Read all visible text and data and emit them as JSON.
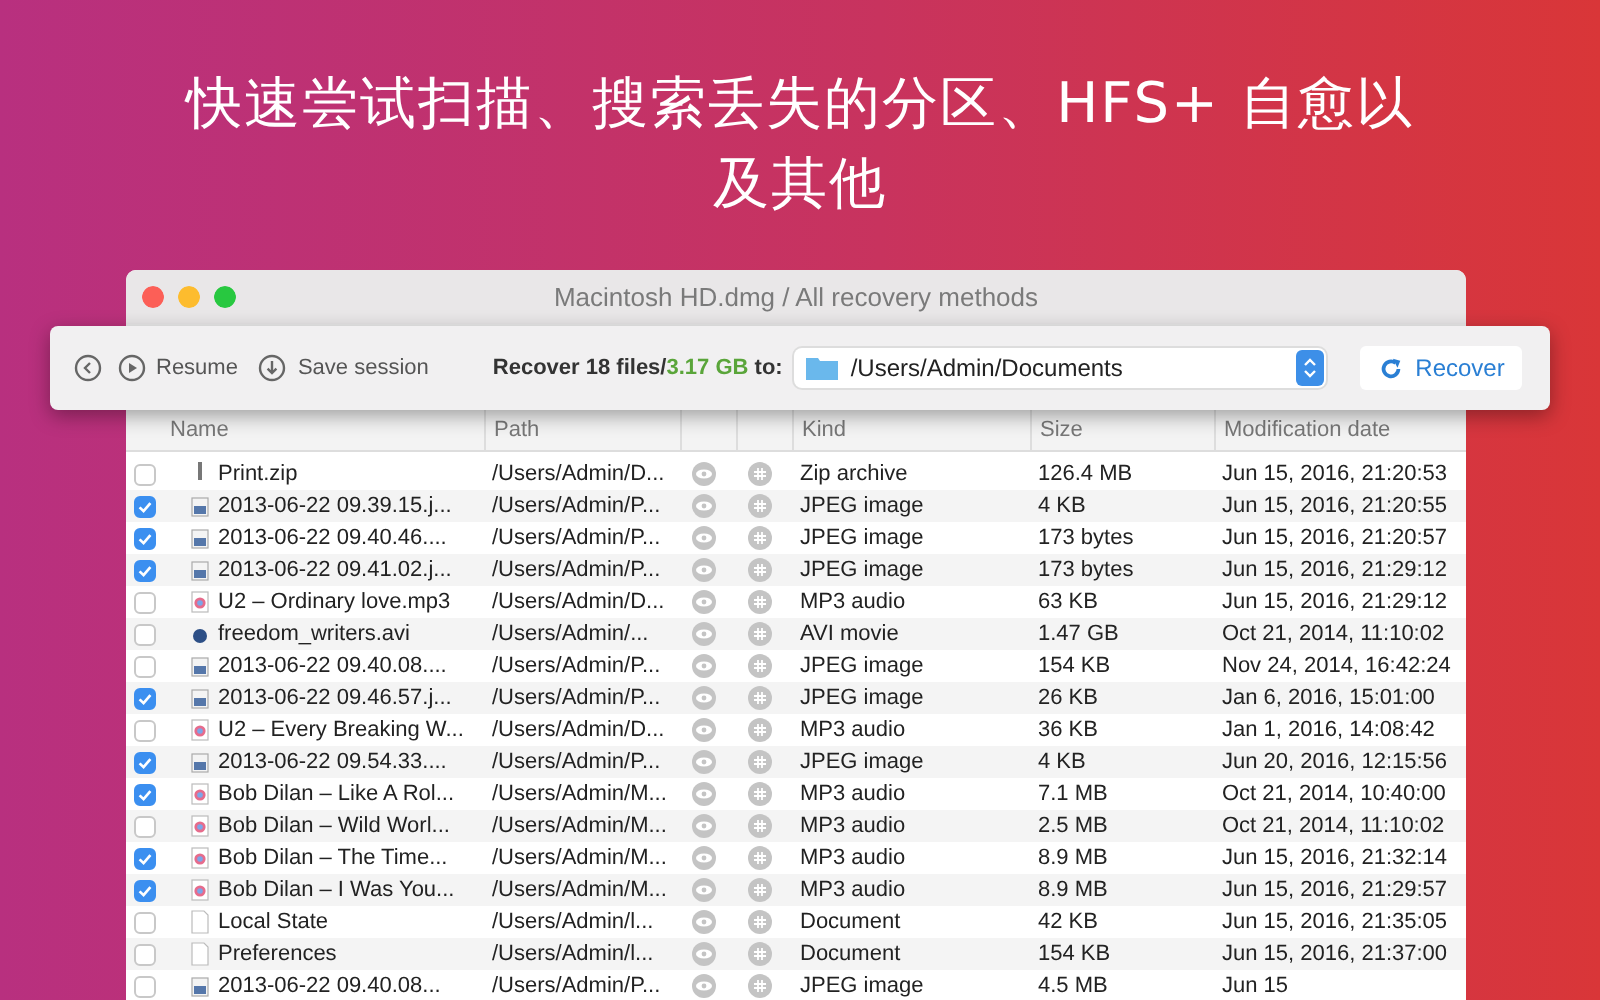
{
  "headline": "快速尝试扫描、搜索丢失的分区、HFS+ 自愈以及其他",
  "window": {
    "title": "Macintosh HD.dmg / All recovery methods"
  },
  "toolbar": {
    "resume": "Resume",
    "save_session": "Save session",
    "summary_prefix": "Recover 18 files/",
    "summary_size": "3.17 GB",
    "summary_suffix": " to:",
    "destination": "/Users/Admin/Documents",
    "recover": "Recover"
  },
  "table": {
    "columns": [
      "Name",
      "Path",
      "Kind",
      "Size",
      "Modification date"
    ],
    "rows": [
      {
        "checked": false,
        "kind": "zip",
        "name": "Print.zip",
        "path": "/Users/Admin/D...",
        "type": "Zip archive",
        "size": "126.4 MB",
        "date": "Jun 15, 2016, 21:20:53"
      },
      {
        "checked": true,
        "kind": "image",
        "name": "2013-06-22 09.39.15.j...",
        "path": "/Users/Admin/P...",
        "type": "JPEG image",
        "size": "4 KB",
        "date": "Jun 15, 2016, 21:20:55"
      },
      {
        "checked": true,
        "kind": "image",
        "name": "2013-06-22 09.40.46....",
        "path": "/Users/Admin/P...",
        "type": "JPEG image",
        "size": "173 bytes",
        "date": "Jun 15, 2016, 21:20:57"
      },
      {
        "checked": true,
        "kind": "image",
        "name": "2013-06-22 09.41.02.j...",
        "path": "/Users/Admin/P...",
        "type": "JPEG image",
        "size": "173 bytes",
        "date": "Jun 15, 2016, 21:29:12"
      },
      {
        "checked": false,
        "kind": "audio",
        "name": "U2 – Ordinary love.mp3",
        "path": "/Users/Admin/D...",
        "type": "MP3 audio",
        "size": "63 KB",
        "date": "Jun 15, 2016, 21:29:12"
      },
      {
        "checked": false,
        "kind": "movie",
        "name": "freedom_writers.avi",
        "path": "/Users/Admin/...",
        "type": "AVI movie",
        "size": "1.47 GB",
        "date": "Oct 21, 2014, 11:10:02"
      },
      {
        "checked": false,
        "kind": "image",
        "name": "2013-06-22 09.40.08....",
        "path": "/Users/Admin/P...",
        "type": "JPEG image",
        "size": "154 KB",
        "date": "Nov 24, 2014, 16:42:24"
      },
      {
        "checked": true,
        "kind": "image",
        "name": "2013-06-22 09.46.57.j...",
        "path": "/Users/Admin/P...",
        "type": "JPEG image",
        "size": "26 KB",
        "date": "Jan 6, 2016, 15:01:00"
      },
      {
        "checked": false,
        "kind": "audio",
        "name": "U2 – Every Breaking W...",
        "path": "/Users/Admin/D...",
        "type": "MP3 audio",
        "size": "36 KB",
        "date": "Jan 1, 2016, 14:08:42"
      },
      {
        "checked": true,
        "kind": "image",
        "name": "2013-06-22 09.54.33....",
        "path": "/Users/Admin/P...",
        "type": "JPEG image",
        "size": "4 KB",
        "date": "Jun 20, 2016, 12:15:56"
      },
      {
        "checked": true,
        "kind": "audio",
        "name": "Bob Dilan – Like A Rol...",
        "path": "/Users/Admin/M...",
        "type": "MP3 audio",
        "size": "7.1 MB",
        "date": "Oct 21, 2014, 10:40:00"
      },
      {
        "checked": false,
        "kind": "audio",
        "name": "Bob Dilan – Wild Worl...",
        "path": "/Users/Admin/M...",
        "type": "MP3 audio",
        "size": "2.5 MB",
        "date": "Oct 21, 2014, 11:10:02"
      },
      {
        "checked": true,
        "kind": "audio",
        "name": "Bob Dilan – The Time...",
        "path": "/Users/Admin/M...",
        "type": "MP3 audio",
        "size": "8.9 MB",
        "date": "Jun 15, 2016, 21:32:14"
      },
      {
        "checked": true,
        "kind": "audio",
        "name": "Bob Dilan – I Was You...",
        "path": "/Users/Admin/M...",
        "type": "MP3 audio",
        "size": "8.9 MB",
        "date": "Jun 15, 2016, 21:29:57"
      },
      {
        "checked": false,
        "kind": "document",
        "name": "Local State",
        "path": "/Users/Admin/l...",
        "type": "Document",
        "size": "42 KB",
        "date": "Jun 15, 2016, 21:35:05"
      },
      {
        "checked": false,
        "kind": "document",
        "name": "Preferences",
        "path": "/Users/Admin/l...",
        "type": "Document",
        "size": "154 KB",
        "date": "Jun 15, 2016, 21:37:00"
      },
      {
        "checked": false,
        "kind": "image",
        "name": "2013-06-22 09.40.08...",
        "path": "/Users/Admin/P...",
        "type": "JPEG image",
        "size": "4.5 MB",
        "date": "Jun 15"
      }
    ]
  }
}
